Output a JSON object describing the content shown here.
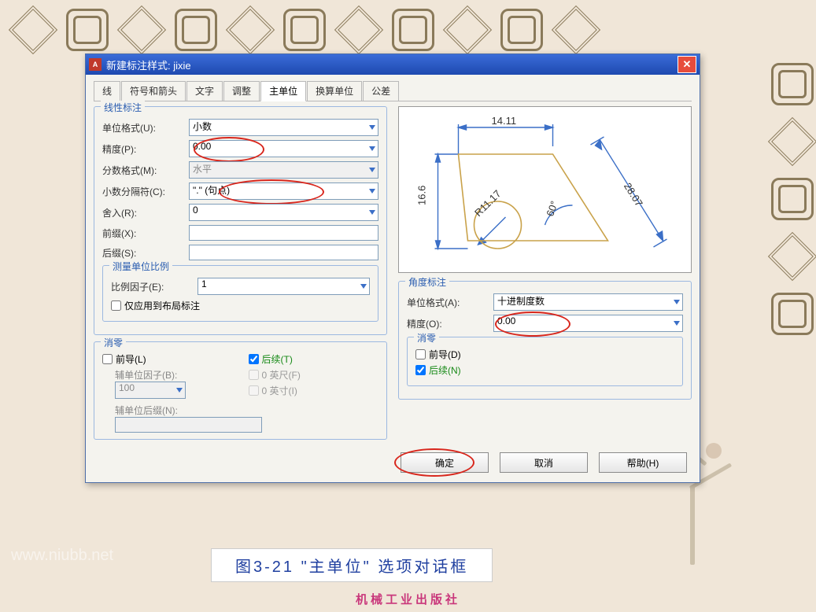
{
  "dialog": {
    "title": "新建标注样式: jixie",
    "tabs": [
      "线",
      "符号和箭头",
      "文字",
      "调整",
      "主单位",
      "换算单位",
      "公差"
    ],
    "active_tab": "主单位"
  },
  "linear": {
    "legend": "线性标注",
    "unit_format_label": "单位格式(U):",
    "unit_format_value": "小数",
    "precision_label": "精度(P):",
    "precision_value": "0.00",
    "fraction_format_label": "分数格式(M):",
    "fraction_format_value": "水平",
    "decimal_sep_label": "小数分隔符(C):",
    "decimal_sep_value": "\".\"  (句点)",
    "round_label": "舍入(R):",
    "round_value": "0",
    "prefix_label": "前缀(X):",
    "prefix_value": "",
    "suffix_label": "后缀(S):",
    "suffix_value": ""
  },
  "scale": {
    "legend": "测量单位比例",
    "factor_label": "比例因子(E):",
    "factor_value": "1",
    "layout_only": "仅应用到布局标注"
  },
  "zero_l": {
    "legend": "消零",
    "leading": "前导(L)",
    "trailing": "后续(T)",
    "subunit_factor_label": "辅单位因子(B):",
    "subunit_factor_value": "100",
    "zero_feet": "0 英尺(F)",
    "zero_inches": "0 英寸(I)",
    "subunit_suffix_label": "辅单位后缀(N):",
    "subunit_suffix_value": ""
  },
  "angular": {
    "legend": "角度标注",
    "unit_label": "单位格式(A):",
    "unit_value": "十进制度数",
    "precision_label": "精度(O):",
    "precision_value": "0.00"
  },
  "zero_a": {
    "legend": "消零",
    "leading": "前导(D)",
    "trailing": "后续(N)"
  },
  "preview_dims": {
    "w": "14.11",
    "h": "16.6",
    "r": "R11.17",
    "ang": "60°",
    "diag": "28.07"
  },
  "buttons": {
    "ok": "确定",
    "cancel": "取消",
    "help": "帮助(H)"
  },
  "caption": "图3-21  \"主单位\" 选项对话框",
  "publisher": "机械工业出版社",
  "watermark": "www.niubb.net"
}
